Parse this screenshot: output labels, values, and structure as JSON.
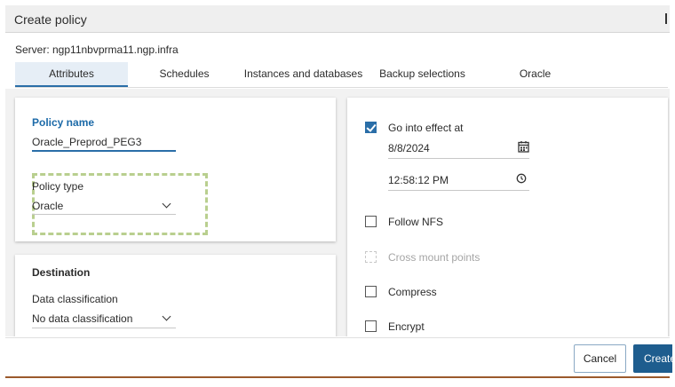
{
  "dialog": {
    "title": "Create policy",
    "server_label": "Server: ngp11nbvprma11.ngp.infra"
  },
  "tabs": [
    {
      "label": "Attributes",
      "active": true
    },
    {
      "label": "Schedules",
      "active": false
    },
    {
      "label": "Instances and databases",
      "active": false
    },
    {
      "label": "Backup selections",
      "active": false
    },
    {
      "label": "Oracle",
      "active": false
    }
  ],
  "attributes": {
    "policy_name_label": "Policy name",
    "policy_name_value": "Oracle_Preprod_PEG3",
    "policy_type_label": "Policy type",
    "policy_type_value": "Oracle"
  },
  "destination": {
    "heading": "Destination",
    "data_classification_label": "Data classification",
    "data_classification_value": "No data classification"
  },
  "options": {
    "go_into_effect_label": "Go into effect at",
    "go_into_effect_checked": true,
    "date_value": "8/8/2024",
    "time_value": "12:58:12 PM",
    "follow_nfs_label": "Follow NFS",
    "cross_mount_label": "Cross mount points",
    "compress_label": "Compress",
    "encrypt_label": "Encrypt"
  },
  "footer": {
    "cancel_label": "Cancel",
    "create_label": "Create"
  },
  "colors": {
    "accent": "#2a6ea8",
    "primary_button": "#1e5d8e",
    "highlight_dashed": "#b9cf8f"
  }
}
